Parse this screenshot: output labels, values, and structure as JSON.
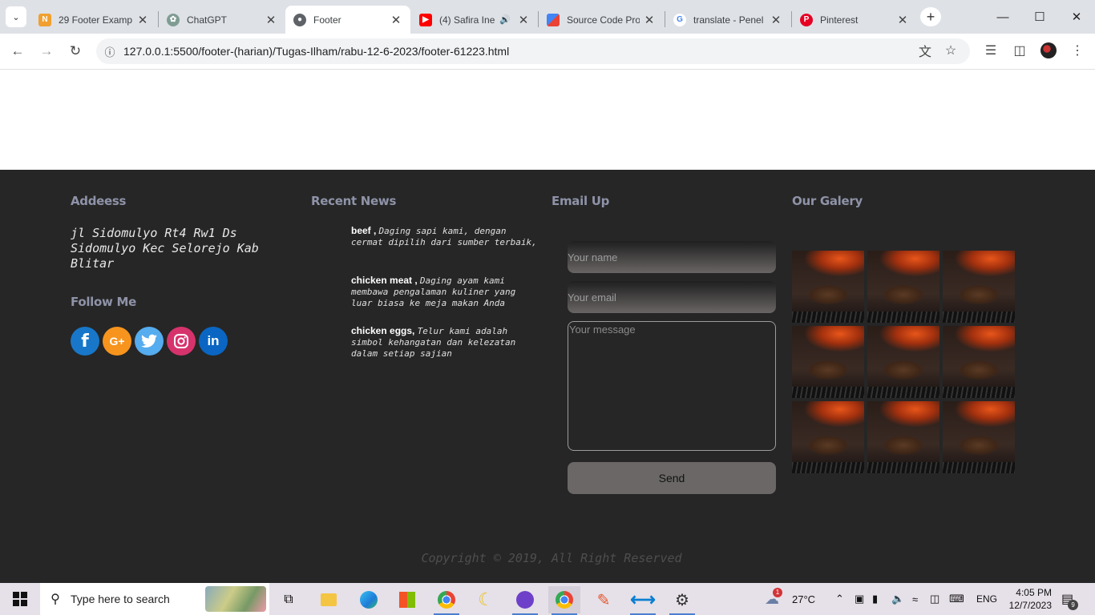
{
  "browser": {
    "tabs": [
      {
        "title": "29 Footer Examp",
        "favicon": "ln"
      },
      {
        "title": "ChatGPT",
        "favicon": "chatgpt"
      },
      {
        "title": "Footer",
        "favicon": "globe",
        "active": true
      },
      {
        "title": "(4) Safira Ine",
        "favicon": "youtube"
      },
      {
        "title": "Source Code Pro",
        "favicon": "google-fonts"
      },
      {
        "title": "translate - Penel",
        "favicon": "google"
      },
      {
        "title": "Pinterest",
        "favicon": "pinterest"
      }
    ],
    "url": "127.0.0.1:5500/footer-(harian)/Tugas-Ilham/rabu-12-6-2023/footer-61223.html"
  },
  "footer": {
    "address": {
      "heading": "Addeess",
      "text": "jl Sidomulyo Rt4 Rw1 Ds Sidomulyo Kec Selorejo Kab Blitar"
    },
    "follow": {
      "heading": "Follow Me",
      "icons": [
        "facebook-icon",
        "google-plus-icon",
        "twitter-icon",
        "instagram-icon",
        "linkedin-icon"
      ],
      "colors": [
        "#1877c9",
        "#f7941d",
        "#55acee",
        "#d6336c",
        "#0a66c2"
      ]
    },
    "news": {
      "heading": "Recent News",
      "items": [
        {
          "title": "beef ,",
          "text": "Daging sapi kami, dengan cermat dipilih dari sumber terbaik,"
        },
        {
          "title": "chicken meat ,",
          "text": "Daging ayam kami membawa pengalaman kuliner yang luar biasa ke meja makan Anda"
        },
        {
          "title": "chicken eggs,",
          "text": "Telur kami adalah simbol kehangatan dan kelezatan dalam setiap sajian"
        }
      ]
    },
    "email": {
      "heading": "Email Up",
      "name_placeholder": "Your name",
      "email_placeholder": "Your email",
      "message_placeholder": "Your message",
      "send_label": "Send"
    },
    "gallery": {
      "heading": "Our Galery",
      "image_count": 9
    },
    "copyright": "Copyright © 2019, All Right Reserved"
  },
  "taskbar": {
    "search_placeholder": "Type here to search",
    "weather": "27°C",
    "weather_badge": "1",
    "language": "ENG",
    "time": "4:05 PM",
    "date": "12/7/2023",
    "notification_count": "9"
  }
}
